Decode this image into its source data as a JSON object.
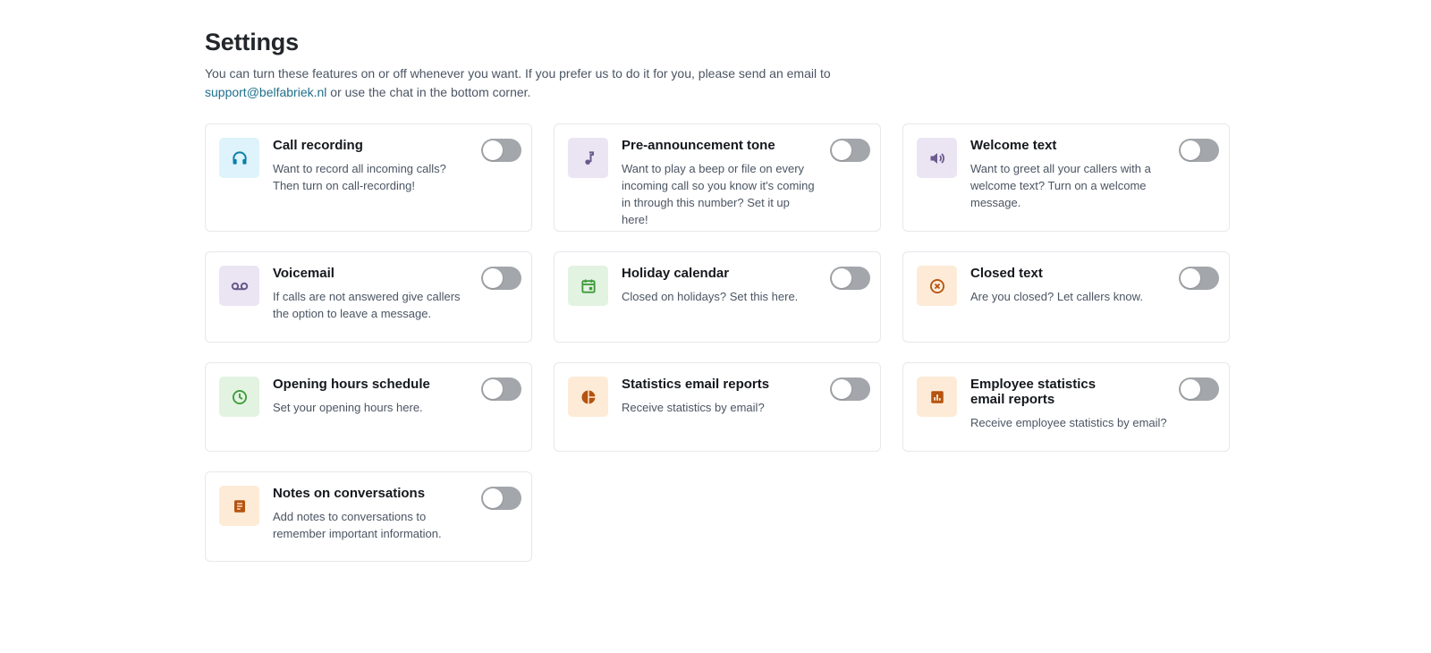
{
  "header": {
    "title": "Settings",
    "intro_before": "You can turn these features on or off whenever you want. If you prefer us to do it for you, please send an email to",
    "email_link": "support@belfabriek.nl",
    "intro_after": "or use the chat in the bottom corner."
  },
  "colors": {
    "accent_blue": "#0e7fa8",
    "accent_purple": "#6b5a8e",
    "accent_green": "#3f9a3a",
    "accent_orange": "#b5530f",
    "toggle_off": "#a3a6aa"
  },
  "features": [
    {
      "title": "Call recording",
      "description": "Want to record all incoming calls? Then turn on call-recording!",
      "icon": "headphones-icon",
      "enabled": false
    },
    {
      "title": "Pre-announcement tone",
      "description": "Want to play a beep or file on every incoming call so you know it's coming in through this number? Set it up here!",
      "icon": "music-note-icon",
      "enabled": false
    },
    {
      "title": "Welcome text",
      "description": "Want to greet all your callers with a welcome text? Turn on a welcome message.",
      "icon": "speaker-icon",
      "enabled": false
    },
    {
      "title": "Voicemail",
      "description": "If calls are not answered give callers the option to leave a message.",
      "icon": "voicemail-icon",
      "enabled": false
    },
    {
      "title": "Holiday calendar",
      "description": "Closed on holidays? Set this here.",
      "icon": "calendar-icon",
      "enabled": false
    },
    {
      "title": "Closed text",
      "description": "Are you closed? Let callers know.",
      "icon": "cancel-circle-icon",
      "enabled": false
    },
    {
      "title": "Opening hours schedule",
      "description": "Set your opening hours here.",
      "icon": "clock-icon",
      "enabled": false
    },
    {
      "title": "Statistics email reports",
      "description": "Receive statistics by email?",
      "icon": "pie-chart-icon",
      "enabled": false
    },
    {
      "title": "Employee statistics email reports",
      "description": "Receive employee statistics by email?",
      "icon": "bar-chart-icon",
      "enabled": false
    },
    {
      "title": "Notes on conversations",
      "description": "Add notes to conversations to remember important information.",
      "icon": "notes-icon",
      "enabled": false
    }
  ]
}
